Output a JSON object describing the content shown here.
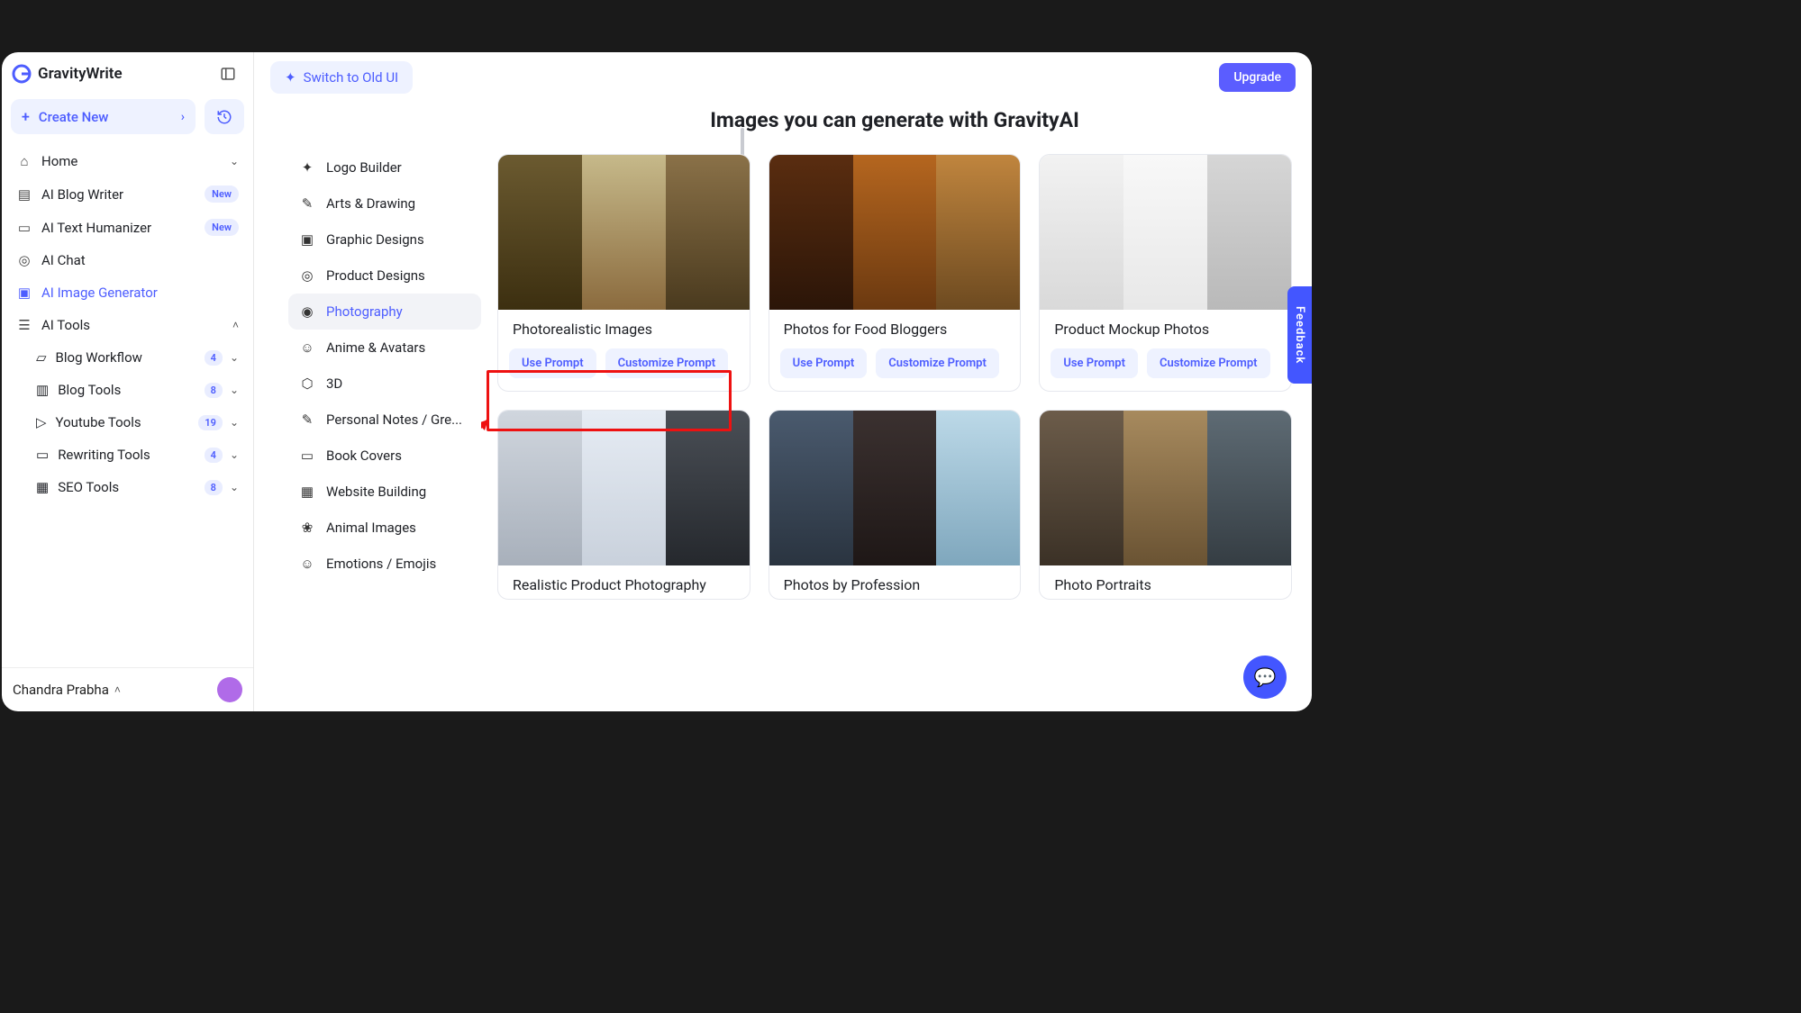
{
  "brand": "GravityWrite",
  "topbar": {
    "switch_label": "Switch to Old UI",
    "upgrade_label": "Upgrade"
  },
  "sidebar": {
    "create_label": "Create New",
    "items": [
      {
        "label": "Home",
        "badge": "",
        "chev": true
      },
      {
        "label": "AI Blog Writer",
        "badge": "New",
        "chev": false
      },
      {
        "label": "AI Text Humanizer",
        "badge": "New",
        "chev": false
      },
      {
        "label": "AI Chat",
        "badge": "",
        "chev": false
      },
      {
        "label": "AI Image Generator",
        "badge": "",
        "chev": false,
        "active": true
      },
      {
        "label": "AI Tools",
        "badge": "",
        "chev": true,
        "expanded": true
      }
    ],
    "tools": [
      {
        "label": "Blog Workflow",
        "count": "4"
      },
      {
        "label": "Blog Tools",
        "count": "8"
      },
      {
        "label": "Youtube Tools",
        "count": "19"
      },
      {
        "label": "Rewriting Tools",
        "count": "4"
      },
      {
        "label": "SEO Tools",
        "count": "8"
      }
    ],
    "user_name": "Chandra Prabha"
  },
  "categories": [
    {
      "label": "Logo Builder"
    },
    {
      "label": "Arts & Drawing"
    },
    {
      "label": "Graphic Designs"
    },
    {
      "label": "Product Designs"
    },
    {
      "label": "Photography",
      "active": true
    },
    {
      "label": "Anime & Avatars"
    },
    {
      "label": "3D"
    },
    {
      "label": "Personal Notes / Gre..."
    },
    {
      "label": "Book Covers"
    },
    {
      "label": "Website Building"
    },
    {
      "label": "Animal Images"
    },
    {
      "label": "Emotions / Emojis"
    }
  ],
  "gallery": {
    "title": "Images you can generate with GravityAI",
    "use_label": "Use Prompt",
    "customize_label": "Customize Prompt",
    "cards": [
      {
        "title": "Photorealistic Images"
      },
      {
        "title": "Photos for Food Bloggers"
      },
      {
        "title": "Product Mockup Photos"
      },
      {
        "title": "Realistic Product Photography"
      },
      {
        "title": "Photos by Profession"
      },
      {
        "title": "Photo Portraits"
      }
    ]
  },
  "feedback_label": "Feedback"
}
